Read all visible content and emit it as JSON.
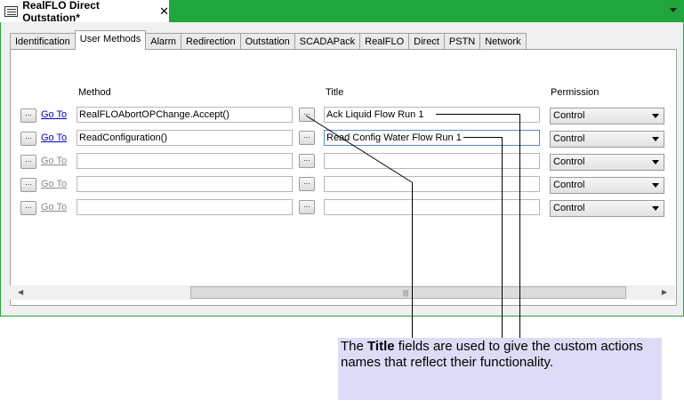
{
  "document_tab": {
    "title": "RealFLO Direct Outstation*",
    "close_glyph": "✕"
  },
  "tabs": [
    "Identification",
    "User Methods",
    "Alarm",
    "Redirection",
    "Outstation",
    "SCADAPack",
    "RealFLO",
    "Direct",
    "PSTN",
    "Network"
  ],
  "active_tab": "User Methods",
  "columns": {
    "method": "Method",
    "title": "Title",
    "permission": "Permission"
  },
  "rows": [
    {
      "browse": "...",
      "goto": "Go To",
      "method": "RealFLOAbortOPChange.Accept()",
      "method_browse": "...",
      "title": "Ack Liquid Flow Run 1",
      "permission": "Control"
    },
    {
      "browse": "...",
      "goto": "Go To",
      "method": "ReadConfiguration()",
      "method_browse": "...",
      "title": "Read Config Water Flow Run 1",
      "permission": "Control"
    },
    {
      "browse": "...",
      "goto": "Go To",
      "method": "",
      "method_browse": "...",
      "title": "",
      "permission": "Control"
    },
    {
      "browse": "...",
      "goto": "Go To",
      "method": "",
      "method_browse": "...",
      "title": "",
      "permission": "Control"
    },
    {
      "browse": "...",
      "goto": "Go To",
      "method": "",
      "method_browse": "...",
      "title": "",
      "permission": "Control"
    }
  ],
  "scrollbar": {
    "left": "◀",
    "right": "▶",
    "grip": "|||"
  },
  "callout": {
    "pre": "The ",
    "bold": "Title",
    "post": " fields are used to give the custom actions names that reflect their functionality."
  },
  "colors": {
    "accent_green": "#1fa63c",
    "callout_bg": "#dcdcf6",
    "link_blue": "#0000cc"
  }
}
